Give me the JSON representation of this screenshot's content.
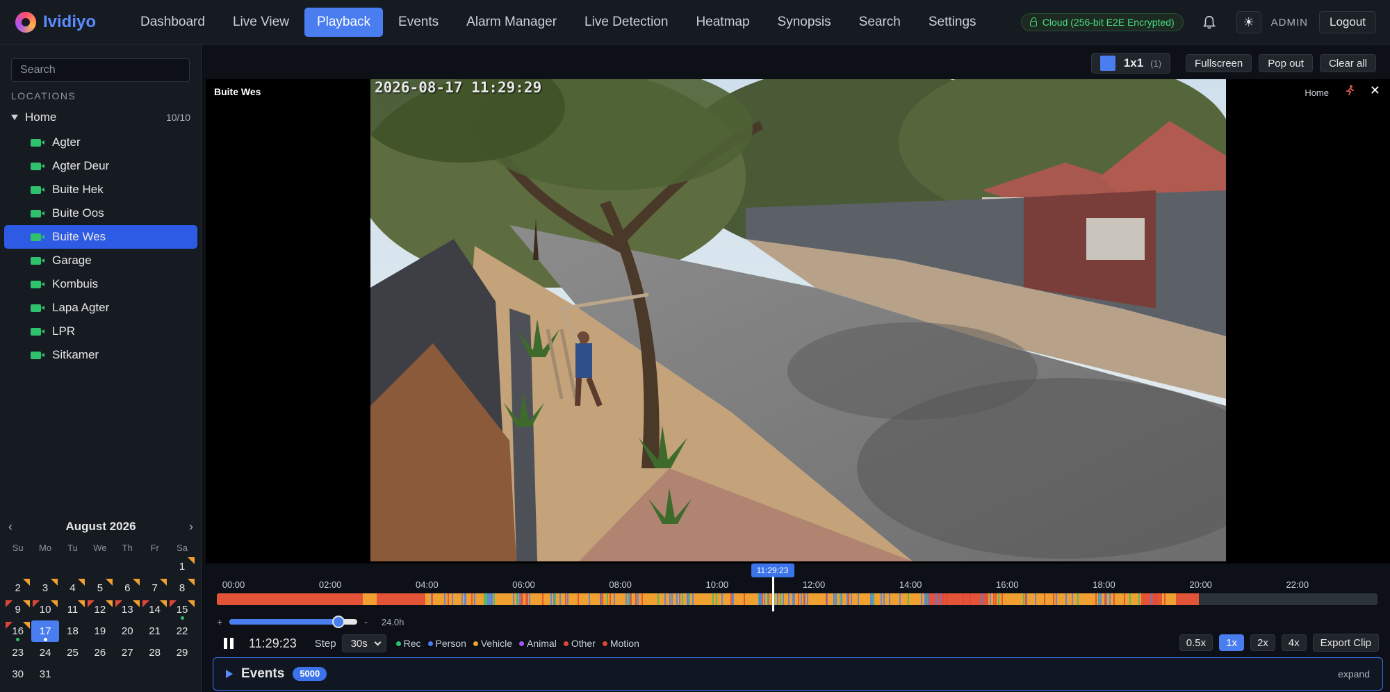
{
  "brand": {
    "name": "Ividiyo"
  },
  "nav": {
    "items": [
      {
        "label": "Dashboard"
      },
      {
        "label": "Live View"
      },
      {
        "label": "Playback",
        "active": true
      },
      {
        "label": "Events"
      },
      {
        "label": "Alarm Manager"
      },
      {
        "label": "Live Detection"
      },
      {
        "label": "Heatmap"
      },
      {
        "label": "Synopsis"
      },
      {
        "label": "Search"
      },
      {
        "label": "Settings"
      }
    ]
  },
  "header": {
    "cloud_label": "Cloud (256-bit E2E Encrypted)",
    "user_label": "ADMIN",
    "logout_label": "Logout"
  },
  "sidebar": {
    "search_placeholder": "Search",
    "locations_heading": "LOCATIONS",
    "site": {
      "name": "Home",
      "count": "10/10"
    },
    "cameras": [
      {
        "name": "Agter"
      },
      {
        "name": "Agter Deur"
      },
      {
        "name": "Buite Hek"
      },
      {
        "name": "Buite Oos"
      },
      {
        "name": "Buite Wes",
        "selected": true
      },
      {
        "name": "Garage"
      },
      {
        "name": "Kombuis"
      },
      {
        "name": "Lapa Agter"
      },
      {
        "name": "LPR"
      },
      {
        "name": "Sitkamer"
      }
    ]
  },
  "calendar": {
    "title": "August 2026",
    "prev": "‹",
    "next": "›",
    "weekdays": [
      "Su",
      "Mo",
      "Tu",
      "We",
      "Th",
      "Fr",
      "Sa"
    ],
    "leading_blanks": 6,
    "days": [
      {
        "d": "1",
        "mark": true
      },
      {
        "d": "2",
        "mark": true
      },
      {
        "d": "3",
        "mark": true
      },
      {
        "d": "4",
        "mark": true
      },
      {
        "d": "5",
        "mark": true
      },
      {
        "d": "6",
        "mark": true
      },
      {
        "d": "7",
        "mark": true
      },
      {
        "d": "8",
        "mark": true
      },
      {
        "d": "9",
        "mark": true,
        "red": true
      },
      {
        "d": "10",
        "mark": true,
        "red": true
      },
      {
        "d": "11",
        "mark": true
      },
      {
        "d": "12",
        "mark": true,
        "red": true
      },
      {
        "d": "13",
        "mark": true,
        "red": true
      },
      {
        "d": "14",
        "mark": true,
        "red": true
      },
      {
        "d": "15",
        "mark": true,
        "red": true,
        "dot": "green"
      },
      {
        "d": "16",
        "mark": true,
        "red": true,
        "dot": "green"
      },
      {
        "d": "17",
        "selected": true,
        "dot": "white"
      },
      {
        "d": "18"
      },
      {
        "d": "19"
      },
      {
        "d": "20"
      },
      {
        "d": "21"
      },
      {
        "d": "22"
      },
      {
        "d": "23"
      },
      {
        "d": "24"
      },
      {
        "d": "25"
      },
      {
        "d": "26"
      },
      {
        "d": "27"
      },
      {
        "d": "28"
      },
      {
        "d": "29"
      },
      {
        "d": "30"
      },
      {
        "d": "31"
      }
    ]
  },
  "toolbar": {
    "layout_label": "1x1",
    "layout_count": "(1)",
    "fullscreen_label": "Fullscreen",
    "popout_label": "Pop out",
    "clear_label": "Clear all"
  },
  "tile": {
    "camera_name": "Buite Wes",
    "site_name": "Home",
    "osd_timestamp": "2026-08-17 11:29:29",
    "close_glyph": "✕"
  },
  "timeline": {
    "ticks": [
      "00:00",
      "02:00",
      "04:00",
      "06:00",
      "08:00",
      "10:00",
      "12:00",
      "14:00",
      "16:00",
      "18:00",
      "20:00",
      "22:00"
    ],
    "playhead_label": "11:29:23",
    "playhead_hour": 11.49,
    "recorded_until_hour": 20.3,
    "zoom_plus": "+",
    "zoom_minus": "-",
    "zoom_value": "24.0h",
    "zoom_fraction": 0.85,
    "current_time": "11:29:23",
    "step_label": "Step",
    "step_value": "30s",
    "legend": [
      {
        "label": "Rec",
        "color": "#2ec26d"
      },
      {
        "label": "Person",
        "color": "#4a7ef0"
      },
      {
        "label": "Vehicle",
        "color": "#f0a030"
      },
      {
        "label": "Animal",
        "color": "#a855f7"
      },
      {
        "label": "Other",
        "color": "#e0453a"
      },
      {
        "label": "Motion",
        "color": "#e0453a"
      }
    ],
    "speeds": [
      {
        "label": "0.5x"
      },
      {
        "label": "1x",
        "active": true
      },
      {
        "label": "2x"
      },
      {
        "label": "4x"
      }
    ],
    "export_label": "Export Clip"
  },
  "events": {
    "title": "Events",
    "count": "5000",
    "expand_label": "expand"
  },
  "colors": {
    "accent": "#4a7ef0",
    "rec": "#2ec26d",
    "vehicle": "#f0a030",
    "motion": "#e0453a",
    "person": "#4a7ef0"
  }
}
